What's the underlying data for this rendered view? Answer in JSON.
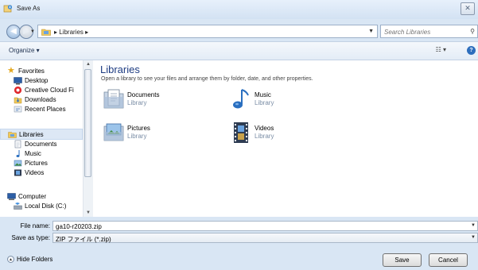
{
  "window": {
    "title": "Save As",
    "close_label": "✕"
  },
  "address": {
    "path": [
      "Libraries"
    ],
    "search_placeholder": "Search Libraries"
  },
  "toolbar": {
    "organize_label": "Organize ▾",
    "views_label": "☷ ▾",
    "help_label": "?"
  },
  "nav": {
    "favorites_label": "Favorites",
    "items": [
      {
        "label": "Desktop",
        "icon": "desktop-icon"
      },
      {
        "label": "Creative Cloud Fi",
        "icon": "creative-cloud-icon"
      },
      {
        "label": "Downloads",
        "icon": "downloads-icon"
      },
      {
        "label": "Recent Places",
        "icon": "recent-places-icon"
      }
    ],
    "libraries_label": "Libraries",
    "library_items": [
      {
        "label": "Documents",
        "icon": "documents-icon"
      },
      {
        "label": "Music",
        "icon": "music-icon"
      },
      {
        "label": "Pictures",
        "icon": "pictures-icon"
      },
      {
        "label": "Videos",
        "icon": "videos-icon"
      }
    ],
    "computer_label": "Computer",
    "computer_items": [
      {
        "label": "Local Disk (C:)",
        "icon": "local-disk-icon"
      }
    ]
  },
  "main": {
    "title": "Libraries",
    "description": "Open a library to see your files and arrange them by folder, date, and other properties.",
    "libraries": [
      {
        "name": "Documents",
        "sub": "Library",
        "icon": "documents-library-icon"
      },
      {
        "name": "Music",
        "sub": "Library",
        "icon": "music-library-icon"
      },
      {
        "name": "Pictures",
        "sub": "Library",
        "icon": "pictures-library-icon"
      },
      {
        "name": "Videos",
        "sub": "Library",
        "icon": "videos-library-icon"
      }
    ]
  },
  "fields": {
    "filename_label": "File name:",
    "filename_value": "ga10-r20203.zip",
    "savetype_label": "Save as type:",
    "savetype_value": "ZIP ファイル (*.zip)"
  },
  "footer": {
    "hide_folders_label": "Hide Folders",
    "save_label": "Save",
    "cancel_label": "Cancel"
  },
  "colors": {
    "accent": "#1e3c82",
    "frame": "#d9e6f4"
  }
}
